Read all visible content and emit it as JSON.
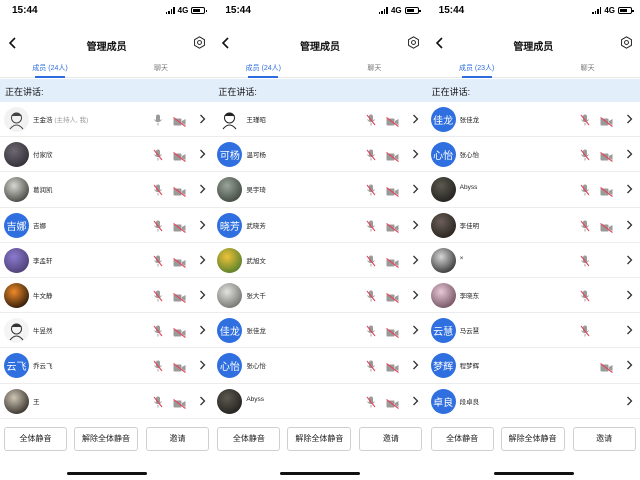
{
  "colors": {
    "accent": "#2d6cdf",
    "speaking_bar": "#e3eefb",
    "icon_gray": "#9a9a9a",
    "muted_red": "#e0475a"
  },
  "panels": [
    {
      "status": {
        "time": "15:44",
        "network": "4G"
      },
      "nav": {
        "title": "管理成员"
      },
      "tabs": [
        {
          "label": "成员 (24人)",
          "active": true
        },
        {
          "label": "聊天",
          "active": false
        }
      ],
      "speaking_label": "正在讲话:",
      "members": [
        {
          "name": "王金浩",
          "note": "(主持人, 我)",
          "avatar": "illustration",
          "avatar_text": "",
          "avatar_colors": [
            "#f2f2f2",
            "#444"
          ],
          "mic": "on",
          "cam": "off"
        },
        {
          "name": "付家欣",
          "note": "",
          "avatar": "photo",
          "avatar_text": "",
          "avatar_colors": [
            "#6d6872",
            "#2e2b33"
          ],
          "mic": "muted",
          "cam": "off"
        },
        {
          "name": "葛润凯",
          "note": "",
          "avatar": "photo",
          "avatar_text": "",
          "avatar_colors": [
            "#d8d8d2",
            "#3b3b36"
          ],
          "mic": "muted",
          "cam": "off"
        },
        {
          "name": "吉娜",
          "note": "",
          "avatar": "text",
          "avatar_text": "吉娜",
          "avatar_colors": [
            "#2f6fe0",
            "#2f6fe0"
          ],
          "mic": "muted",
          "cam": "off"
        },
        {
          "name": "李孟轩",
          "note": "",
          "avatar": "photo",
          "avatar_text": "",
          "avatar_colors": [
            "#8a7ad0",
            "#4a3b6e"
          ],
          "mic": "muted",
          "cam": "off"
        },
        {
          "name": "牛文静",
          "note": "",
          "avatar": "photo",
          "avatar_text": "",
          "avatar_colors": [
            "#f08a2a",
            "#1d1208"
          ],
          "mic": "muted",
          "cam": "off"
        },
        {
          "name": "牛昱然",
          "note": "",
          "avatar": "illustration",
          "avatar_text": "",
          "avatar_colors": [
            "#f4f4f4",
            "#333"
          ],
          "mic": "muted",
          "cam": "off"
        },
        {
          "name": "乔云飞",
          "note": "",
          "avatar": "text",
          "avatar_text": "云飞",
          "avatar_colors": [
            "#2f6fe0",
            "#2f6fe0"
          ],
          "mic": "muted",
          "cam": "off"
        },
        {
          "name": "王",
          "note": "",
          "avatar": "photo",
          "avatar_text": "",
          "avatar_colors": [
            "#cfc6b5",
            "#2a2620"
          ],
          "mic": "muted",
          "cam": "off"
        }
      ],
      "buttons": {
        "mute_all": "全体静音",
        "unmute_all": "解除全体静音",
        "invite": "邀请"
      }
    },
    {
      "status": {
        "time": "15:44",
        "network": "4G"
      },
      "nav": {
        "title": "管理成员"
      },
      "tabs": [
        {
          "label": "成员 (24人)",
          "active": true
        },
        {
          "label": "聊天",
          "active": false
        }
      ],
      "speaking_label": "正在讲话:",
      "members": [
        {
          "name": "王瑾昭",
          "note": "",
          "avatar": "illustration",
          "avatar_text": "",
          "avatar_colors": [
            "#ffffff",
            "#222"
          ],
          "mic": "muted",
          "cam": "off"
        },
        {
          "name": "温可杨",
          "note": "",
          "avatar": "text",
          "avatar_text": "可杨",
          "avatar_colors": [
            "#2f6fe0",
            "#2f6fe0"
          ],
          "mic": "muted",
          "cam": "off"
        },
        {
          "name": "吴宇琦",
          "note": "",
          "avatar": "photo",
          "avatar_text": "",
          "avatar_colors": [
            "#9aa49a",
            "#3a423a"
          ],
          "mic": "muted",
          "cam": "off"
        },
        {
          "name": "武晓芳",
          "note": "",
          "avatar": "text",
          "avatar_text": "晓芳",
          "avatar_colors": [
            "#2f6fe0",
            "#2f6fe0"
          ],
          "mic": "muted",
          "cam": "off"
        },
        {
          "name": "武旭文",
          "note": "",
          "avatar": "photo",
          "avatar_text": "",
          "avatar_colors": [
            "#f0c23a",
            "#4a7a2a"
          ],
          "mic": "muted",
          "cam": "off"
        },
        {
          "name": "张大千",
          "note": "",
          "avatar": "photo",
          "avatar_text": "",
          "avatar_colors": [
            "#e2e2de",
            "#6a6a66"
          ],
          "mic": "muted",
          "cam": "off"
        },
        {
          "name": "张佳龙",
          "note": "",
          "avatar": "text",
          "avatar_text": "佳龙",
          "avatar_colors": [
            "#2f6fe0",
            "#2f6fe0"
          ],
          "mic": "muted",
          "cam": "off"
        },
        {
          "name": "张心怡",
          "note": "",
          "avatar": "text",
          "avatar_text": "心怡",
          "avatar_colors": [
            "#2f6fe0",
            "#2f6fe0"
          ],
          "mic": "muted",
          "cam": "off"
        },
        {
          "name": "Abyss",
          "note": "",
          "avatar": "photo",
          "avatar_text": "",
          "avatar_colors": [
            "#5c5a50",
            "#1e1d1a"
          ],
          "mic": "muted",
          "cam": "off"
        }
      ],
      "buttons": {
        "mute_all": "全体静音",
        "unmute_all": "解除全体静音",
        "invite": "邀请"
      }
    },
    {
      "status": {
        "time": "15:44",
        "network": "4G"
      },
      "nav": {
        "title": "管理成员"
      },
      "tabs": [
        {
          "label": "成员 (23人)",
          "active": true
        },
        {
          "label": "聊天",
          "active": false
        }
      ],
      "speaking_label": "正在讲话:",
      "members": [
        {
          "name": "张佳龙",
          "note": "",
          "avatar": "text",
          "avatar_text": "佳龙",
          "avatar_colors": [
            "#2f6fe0",
            "#2f6fe0"
          ],
          "mic": "muted",
          "cam": "off"
        },
        {
          "name": "张心怡",
          "note": "",
          "avatar": "text",
          "avatar_text": "心怡",
          "avatar_colors": [
            "#2f6fe0",
            "#2f6fe0"
          ],
          "mic": "muted",
          "cam": "off"
        },
        {
          "name": "Abyss",
          "note": "",
          "avatar": "photo",
          "avatar_text": "",
          "avatar_colors": [
            "#5c5a50",
            "#1e1d1a"
          ],
          "mic": "muted",
          "cam": "off"
        },
        {
          "name": "李佳明",
          "note": "",
          "avatar": "photo",
          "avatar_text": "",
          "avatar_colors": [
            "#6a5f58",
            "#241e1a"
          ],
          "mic": "muted",
          "cam": "off"
        },
        {
          "name": "×",
          "note": "",
          "avatar": "photo",
          "avatar_text": "",
          "avatar_colors": [
            "#d6d6d6",
            "#2a2a2a"
          ],
          "mic": "muted",
          "cam": "none"
        },
        {
          "name": "李晓东",
          "note": "",
          "avatar": "photo",
          "avatar_text": "",
          "avatar_colors": [
            "#e8c8d6",
            "#6a4a5a"
          ],
          "mic": "muted",
          "cam": "none"
        },
        {
          "name": "马云慧",
          "note": "",
          "avatar": "text",
          "avatar_text": "云慧",
          "avatar_colors": [
            "#2f6fe0",
            "#2f6fe0"
          ],
          "mic": "muted",
          "cam": "none"
        },
        {
          "name": "程梦辉",
          "note": "",
          "avatar": "text",
          "avatar_text": "梦辉",
          "avatar_colors": [
            "#2f6fe0",
            "#2f6fe0"
          ],
          "mic": "none",
          "cam": "off"
        },
        {
          "name": "段卓良",
          "note": "",
          "avatar": "text",
          "avatar_text": "卓良",
          "avatar_colors": [
            "#2f6fe0",
            "#2f6fe0"
          ],
          "mic": "none",
          "cam": "none"
        }
      ],
      "buttons": {
        "mute_all": "全体静音",
        "unmute_all": "解除全体静音",
        "invite": "邀请"
      }
    }
  ]
}
